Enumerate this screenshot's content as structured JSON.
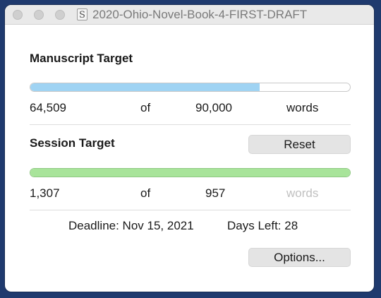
{
  "window": {
    "title": "2020-Ohio-Novel-Book-4-FIRST-DRAFT",
    "app_icon_glyph": "S"
  },
  "manuscript": {
    "title": "Manuscript Target",
    "progress_fraction": 0.7168,
    "current": "64,509",
    "of": "of",
    "target": "90,000",
    "unit": "words"
  },
  "session": {
    "title": "Session Target",
    "reset_label": "Reset",
    "progress_fraction": 1.0,
    "current": "1,307",
    "of": "of",
    "target": "957",
    "unit": "words"
  },
  "deadline": {
    "text": "Deadline: Nov 15, 2021",
    "days_left": "Days Left: 28"
  },
  "options_label": "Options...",
  "colors": {
    "manuscript_fill": "#9fd3f3",
    "session_fill": "#a8e49a",
    "disabled_text": "#c0c0c0"
  }
}
